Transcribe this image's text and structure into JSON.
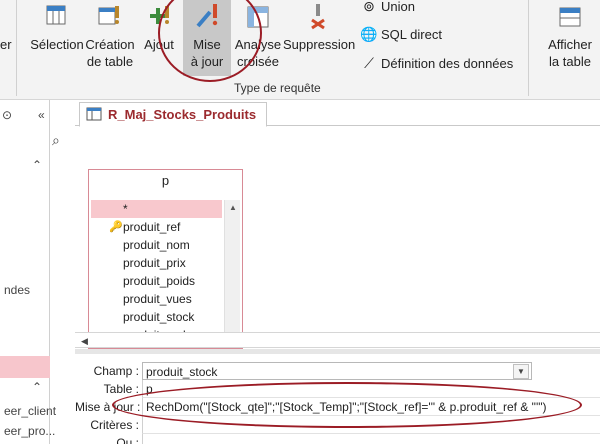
{
  "ribbon": {
    "left_partial_label": "er",
    "selection": "Sélection",
    "creation_line1": "Création",
    "creation_line2": "de table",
    "ajout": "Ajout",
    "mise_line1": "Mise",
    "mise_line2": "à jour",
    "analyse_line1": "Analyse",
    "analyse_line2": "croisée",
    "suppression": "Suppression",
    "union": "Union",
    "sql_direct": "SQL direct",
    "definition": "Définition des données",
    "afficher_line1": "Afficher",
    "afficher_line2": "la table",
    "group_label": "Type de requête"
  },
  "nav": {
    "item_partial_1": "ndes",
    "item_partial_2": "eer_client",
    "item_partial_3": "eer_pro..."
  },
  "tab": {
    "title": "R_Maj_Stocks_Produits"
  },
  "table_box": {
    "name": "p",
    "fields": [
      "*",
      "produit_ref",
      "produit_nom",
      "produit_prix",
      "produit_poids",
      "produit_vues",
      "produit_stock",
      "produit_code"
    ],
    "key_icon": "primary-key-icon"
  },
  "grid": {
    "labels": {
      "champ": "Champ :",
      "table": "Table :",
      "mise_a_jour": "Mise à jour :",
      "criteres": "Critères :",
      "ou": "Ou :"
    },
    "champ_value": "produit_stock",
    "table_value": "p",
    "update_value": "RechDom(\"[Stock_qte]\";\"[Stock_Temp]\";\"[Stock_ref]='\" & p.produit_ref & \"'\")",
    "criteres_value": "",
    "ou_value": ""
  },
  "colors": {
    "annotation": "#9b1c25",
    "selection": "#f8c8cd",
    "tab_text": "#9b2a2e"
  }
}
